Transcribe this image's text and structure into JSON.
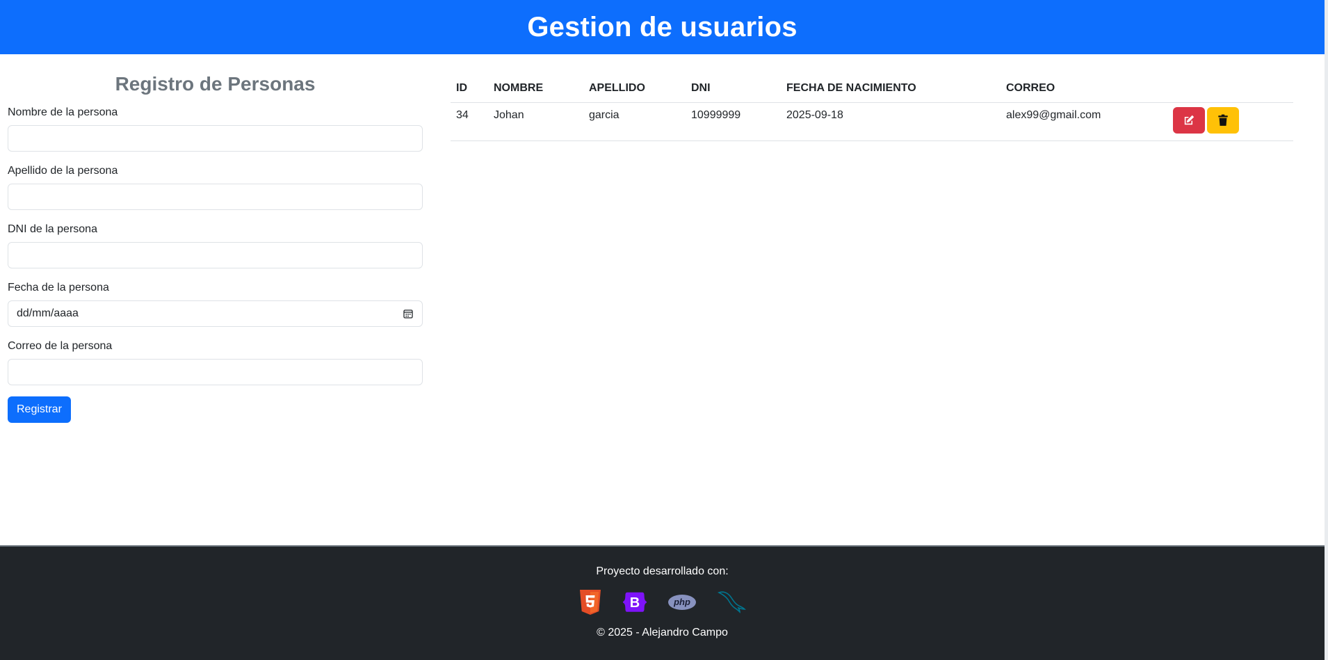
{
  "header": {
    "title": "Gestion de usuarios"
  },
  "form": {
    "title": "Registro de Personas",
    "fields": [
      {
        "label": "Nombre de la persona",
        "value": ""
      },
      {
        "label": "Apellido de la persona",
        "value": ""
      },
      {
        "label": "DNI de la persona",
        "value": ""
      },
      {
        "label": "Fecha de la persona",
        "value": "",
        "placeholder": "dd/mm/aaaa"
      },
      {
        "label": "Correo de la persona",
        "value": ""
      }
    ],
    "submit_label": "Registrar"
  },
  "table": {
    "headers": [
      "ID",
      "NOMBRE",
      "APELLIDO",
      "DNI",
      "FECHA DE NACIMIENTO",
      "CORREO"
    ],
    "rows": [
      {
        "id": "34",
        "nombre": "Johan",
        "apellido": "garcia",
        "dni": "10999999",
        "fecha": "2025-09-18",
        "correo": "alex99@gmail.com"
      }
    ],
    "actions": {
      "edit_icon": "edit-icon",
      "delete_icon": "trash-icon"
    }
  },
  "footer": {
    "caption": "Proyecto desarrollado con:",
    "tech_icons": [
      "html5-icon",
      "bootstrap-icon",
      "php-icon",
      "mysql-icon"
    ],
    "tech_labels": {
      "bootstrap": "B",
      "php": "php"
    },
    "copyright": "© 2025 - Alejandro Campo"
  },
  "colors": {
    "primary": "#0d6efd",
    "danger": "#dc3545",
    "warning": "#ffc107",
    "footer_bg": "#212529",
    "muted": "#6c757d"
  }
}
